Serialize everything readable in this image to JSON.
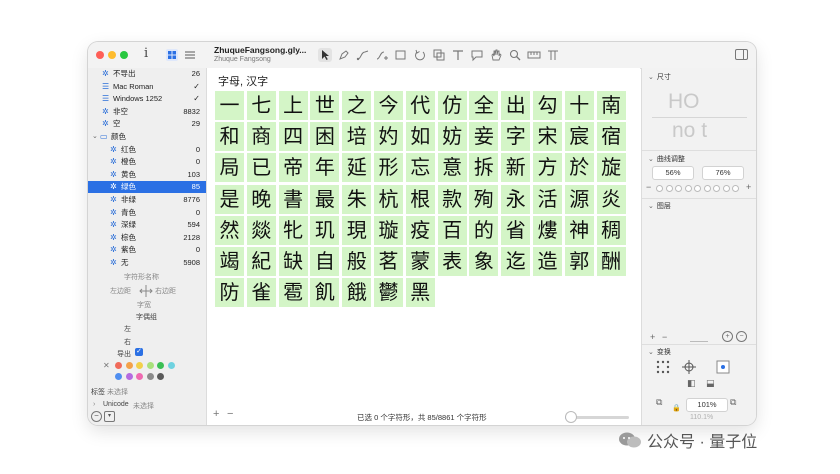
{
  "toolbar": {
    "info_glyph": "i",
    "doc_title": "ZhuqueFangsong.gly...",
    "doc_subtitle": "Zhuque Fangsong",
    "tools": [
      "select-arrow",
      "pen-tool",
      "draw-tool",
      "brush-tool",
      "rectangle-tool",
      "rotate-tool",
      "component-tool",
      "text-tool",
      "annotation-tool",
      "hand-tool",
      "zoom-tool",
      "measure-tool",
      "kerning-tool"
    ]
  },
  "sidebar": {
    "items": [
      {
        "label": "不导出",
        "count": "26",
        "icon": "gear-icon",
        "indent": 1
      },
      {
        "label": "Mac Roman",
        "check": "✓",
        "icon": "list-icon",
        "indent": 1
      },
      {
        "label": "Windows 1252",
        "check": "✓",
        "icon": "list-icon",
        "indent": 1
      },
      {
        "label": "非空",
        "count": "8832",
        "icon": "gear-icon",
        "indent": 1
      },
      {
        "label": "空",
        "count": "29",
        "icon": "gear-icon",
        "indent": 1
      },
      {
        "label": "颜色",
        "icon": "folder-icon",
        "indent": 0,
        "disclosure": "⌄"
      },
      {
        "label": "红色",
        "count": "0",
        "icon": "gear-icon",
        "indent": 2
      },
      {
        "label": "橙色",
        "count": "0",
        "icon": "gear-icon",
        "indent": 2
      },
      {
        "label": "黄色",
        "count": "103",
        "icon": "gear-icon",
        "indent": 2
      },
      {
        "label": "绿色",
        "count": "85",
        "icon": "gear-icon",
        "indent": 2,
        "selected": true
      },
      {
        "label": "非绿",
        "count": "8776",
        "icon": "gear-icon",
        "indent": 2
      },
      {
        "label": "青色",
        "count": "0",
        "icon": "gear-icon",
        "indent": 2
      },
      {
        "label": "深绿",
        "count": "594",
        "icon": "gear-icon",
        "indent": 2
      },
      {
        "label": "棕色",
        "count": "2128",
        "icon": "gear-icon",
        "indent": 2
      },
      {
        "label": "紫色",
        "count": "0",
        "icon": "gear-icon",
        "indent": 2
      },
      {
        "label": "无",
        "count": "5908",
        "icon": "gear-icon",
        "indent": 2
      }
    ],
    "glyph_name_label": "字符形名称",
    "left_margin_label": "左边距",
    "right_margin_label": "右边距",
    "width_label": "字宽",
    "pair_group_label": "字偶组",
    "left_label": "左",
    "right_label": "右",
    "export_label": "导出",
    "tag_label": "标签",
    "tag_value": "未选择",
    "unicode_label": "Unicode",
    "unicode_value": "未选择",
    "swatch_colors": [
      "#f06a5a",
      "#f3a14a",
      "#f2d04a",
      "#a8e07b",
      "#3bbf55",
      "#6fd2e0",
      "#4f8ef0",
      "#b56be0",
      "#ef6ab1",
      "#8b8b8b",
      "#5a5a5a"
    ]
  },
  "main": {
    "section_title": "字母, 汉字",
    "glyphs": [
      "一",
      "七",
      "上",
      "世",
      "之",
      "今",
      "代",
      "仿",
      "全",
      "出",
      "勾",
      "十",
      "南",
      "和",
      "商",
      "四",
      "困",
      "培",
      "妁",
      "如",
      "妨",
      "妾",
      "字",
      "宋",
      "宸",
      "宿",
      "局",
      "已",
      "帝",
      "年",
      "延",
      "形",
      "忘",
      "意",
      "拆",
      "新",
      "方",
      "於",
      "旋",
      "是",
      "晚",
      "書",
      "最",
      "朱",
      "杭",
      "根",
      "款",
      "殉",
      "永",
      "活",
      "源",
      "炎",
      "然",
      "燚",
      "牝",
      "玑",
      "現",
      "璇",
      "疫",
      "百",
      "的",
      "省",
      "熡",
      "神",
      "稠",
      "竭",
      "紀",
      "缺",
      "自",
      "般",
      "茗",
      "蒙",
      "表",
      "象",
      "迄",
      "造",
      "郭",
      "酬",
      "防",
      "雀",
      "雹",
      "飢",
      "餓",
      "鬱",
      "黑"
    ],
    "highlight_color": "#d4f5c7",
    "status_text": "已选 0 个字符形，共 85/8861 个字符形",
    "zoom_slider_value": 0.1
  },
  "right_panel": {
    "size_title": "尺寸",
    "metric_line1": "HO",
    "metric_line2": "no t",
    "curve_title": "曲线调整",
    "curve_values": [
      "56%",
      "76%"
    ],
    "layers_title": "图层",
    "transform_title": "变换",
    "zoom_value": "101%",
    "zoom_value2": "110.1%"
  },
  "watermark": {
    "text": "公众号 · 量子位"
  },
  "colors": {
    "accent": "#2b70e4",
    "close": "#fe5f57",
    "minimize": "#febc2e",
    "zoom": "#28c840"
  }
}
